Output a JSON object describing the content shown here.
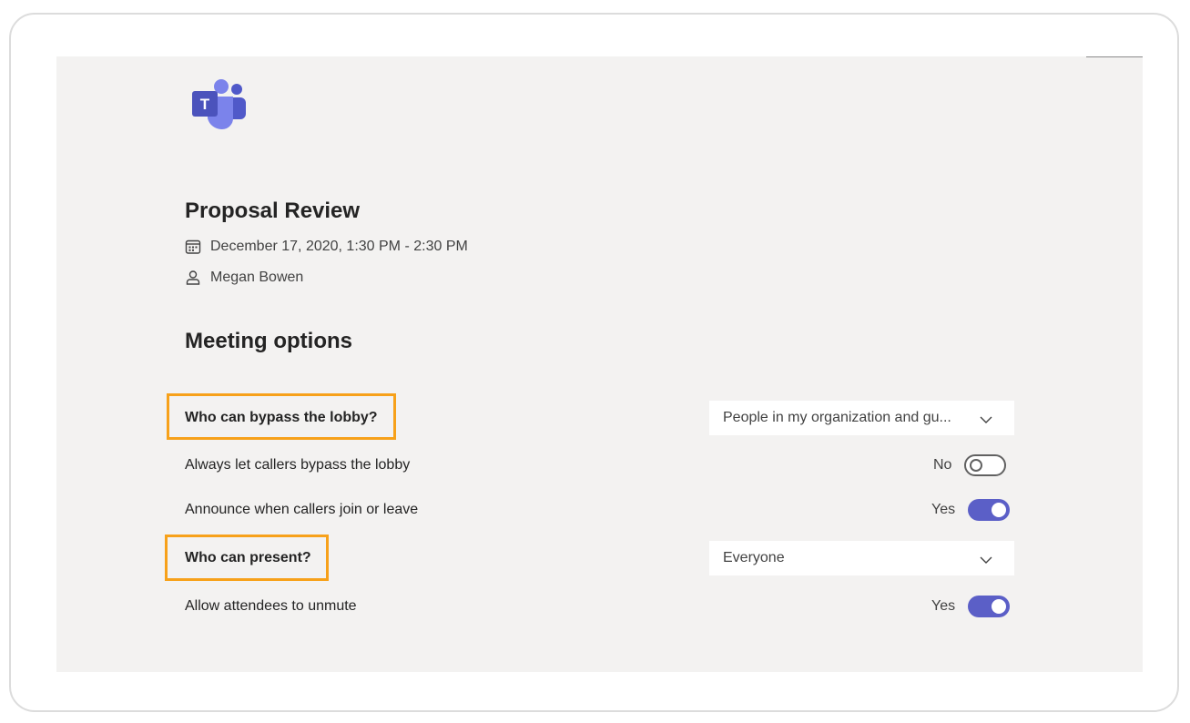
{
  "meeting": {
    "title": "Proposal Review",
    "datetime": "December 17, 2020, 1:30 PM - 2:30 PM",
    "organizer": "Megan Bowen"
  },
  "logo": {
    "icon": "microsoft-teams-logo",
    "letter": "T",
    "brand_color": "#5059c9",
    "accent_color": "#7b83eb"
  },
  "section": {
    "title": "Meeting options"
  },
  "options": {
    "bypass_lobby": {
      "label": "Who can bypass the lobby?",
      "value": "People in my organization and gu..."
    },
    "callers_bypass": {
      "label": "Always let callers bypass the lobby",
      "state_text": "No",
      "enabled": false
    },
    "announce_callers": {
      "label": "Announce when callers join or leave",
      "state_text": "Yes",
      "enabled": true
    },
    "who_can_present": {
      "label": "Who can present?",
      "value": "Everyone"
    },
    "allow_unmute": {
      "label": "Allow attendees to unmute",
      "state_text": "Yes",
      "enabled": true
    }
  },
  "colors": {
    "highlight": "#f7a11a",
    "toggle_on": "#5b5fc7",
    "panel_background": "#f3f2f1"
  }
}
